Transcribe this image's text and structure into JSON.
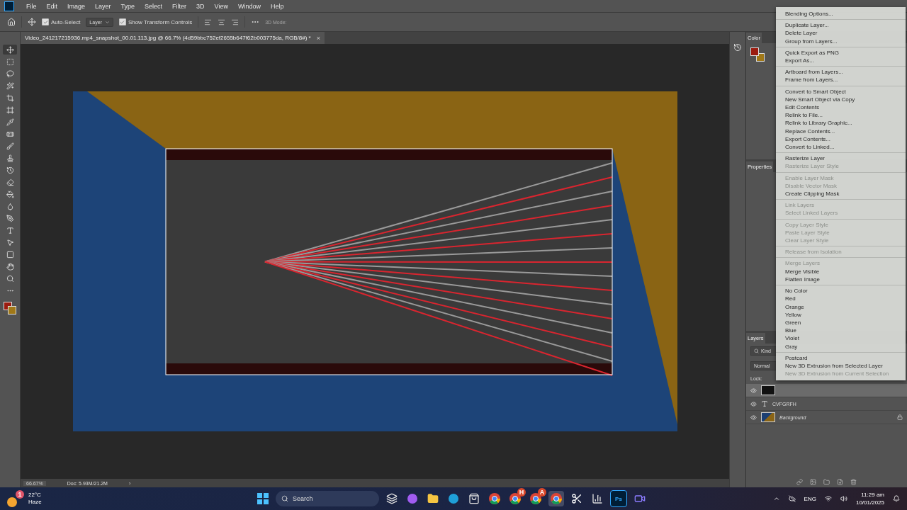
{
  "menubar": {
    "items": [
      "File",
      "Edit",
      "Image",
      "Layer",
      "Type",
      "Select",
      "Filter",
      "3D",
      "View",
      "Window",
      "Help"
    ]
  },
  "options_bar": {
    "auto_select": {
      "label": "Auto-Select",
      "checked": true
    },
    "target": {
      "value": "Layer"
    },
    "transform_controls": {
      "label": "Show Transform Controls",
      "checked": true
    },
    "mode_3d": {
      "label": "3D Mode:",
      "disabled": true
    }
  },
  "toolbar": {
    "tools": [
      {
        "selected": true
      },
      {
        "selected": false
      },
      {
        "selected": false
      },
      {
        "selected": false
      },
      {
        "selected": false
      },
      {
        "selected": false
      },
      {
        "selected": false
      },
      {
        "selected": false
      },
      {
        "selected": false
      },
      {
        "selected": false
      },
      {
        "selected": false
      },
      {
        "selected": false
      },
      {
        "selected": false
      },
      {
        "selected": false
      },
      {
        "selected": false
      },
      {
        "selected": false
      },
      {
        "selected": false
      },
      {
        "selected": false
      },
      {
        "selected": false
      },
      {
        "selected": false
      },
      {
        "selected": false
      }
    ]
  },
  "document_tab": {
    "title": "Video_241217215936.mp4_snapshot_00.01.113.jpg @ 66.7% (4d59bbc752ef2655b647f62b003775da, RGB/8#) *",
    "close": "×"
  },
  "status_bar": {
    "zoom": "66.67%",
    "doc": "Doc: 5.93M/21.2M",
    "arrow": "›"
  },
  "panels": {
    "color": {
      "title": "Color"
    },
    "properties": {
      "title": "Properties"
    },
    "layers": {
      "title": "Layers",
      "filter": "Kind",
      "blend_mode": "Normal",
      "lock": "Lock:",
      "layers": [
        {
          "kind": "smart",
          "visible": true,
          "selected": true,
          "locked": false
        },
        {
          "kind": "text",
          "name": "CVFGRFH",
          "visible": true,
          "selected": false,
          "locked": false
        },
        {
          "kind": "image",
          "name": "Background",
          "visible": true,
          "selected": false,
          "locked": true
        }
      ]
    }
  },
  "context_menu": {
    "groups": [
      [
        {
          "label": "Blending Options...",
          "disabled": false
        }
      ],
      [
        {
          "label": "Duplicate Layer...",
          "disabled": false
        },
        {
          "label": "Delete Layer",
          "disabled": false
        },
        {
          "label": "Group from Layers...",
          "disabled": false
        }
      ],
      [
        {
          "label": "Quick Export as PNG",
          "disabled": false
        },
        {
          "label": "Export As...",
          "disabled": false
        }
      ],
      [
        {
          "label": "Artboard from Layers...",
          "disabled": false
        },
        {
          "label": "Frame from Layers...",
          "disabled": false
        }
      ],
      [
        {
          "label": "Convert to Smart Object",
          "disabled": false
        },
        {
          "label": "New Smart Object via Copy",
          "disabled": false
        },
        {
          "label": "Edit Contents",
          "disabled": false
        },
        {
          "label": "Relink to File...",
          "disabled": false
        },
        {
          "label": "Relink to Library Graphic...",
          "disabled": false
        },
        {
          "label": "Replace Contents...",
          "disabled": false
        },
        {
          "label": "Export Contents...",
          "disabled": false
        },
        {
          "label": "Convert to Linked...",
          "disabled": false
        }
      ],
      [
        {
          "label": "Rasterize Layer",
          "disabled": false
        },
        {
          "label": "Rasterize Layer Style",
          "disabled": true
        }
      ],
      [
        {
          "label": "Enable Layer Mask",
          "disabled": true
        },
        {
          "label": "Disable Vector Mask",
          "disabled": true
        },
        {
          "label": "Create Clipping Mask",
          "disabled": false
        }
      ],
      [
        {
          "label": "Link Layers",
          "disabled": true
        },
        {
          "label": "Select Linked Layers",
          "disabled": true
        }
      ],
      [
        {
          "label": "Copy Layer Style",
          "disabled": true
        },
        {
          "label": "Paste Layer Style",
          "disabled": true
        },
        {
          "label": "Clear Layer Style",
          "disabled": true
        }
      ],
      [
        {
          "label": "Release from Isolation",
          "disabled": true
        }
      ],
      [
        {
          "label": "Merge Layers",
          "disabled": true
        },
        {
          "label": "Merge Visible",
          "disabled": false
        },
        {
          "label": "Flatten Image",
          "disabled": false
        }
      ],
      [
        {
          "label": "No Color",
          "disabled": false
        },
        {
          "label": "Red",
          "disabled": false
        },
        {
          "label": "Orange",
          "disabled": false
        },
        {
          "label": "Yellow",
          "disabled": false
        },
        {
          "label": "Green",
          "disabled": false
        },
        {
          "label": "Blue",
          "disabled": false
        },
        {
          "label": "Violet",
          "disabled": false
        },
        {
          "label": "Gray",
          "disabled": false
        }
      ],
      [
        {
          "label": "Postcard",
          "disabled": false
        },
        {
          "label": "New 3D Extrusion from Selected Layer",
          "disabled": false
        },
        {
          "label": "New 3D Extrusion from Current Selection",
          "disabled": true
        }
      ]
    ]
  },
  "taskbar": {
    "weather": {
      "temperature": "22°C",
      "condition": "Haze",
      "badge": "1"
    },
    "search": {
      "placeholder": "Search"
    },
    "apps": [
      {
        "kind": "windows"
      },
      {
        "kind": "taskview"
      },
      {
        "kind": "copilot"
      },
      {
        "kind": "folder"
      },
      {
        "kind": "edge"
      },
      {
        "kind": "store"
      },
      {
        "kind": "chrome",
        "selected": false
      },
      {
        "kind": "chrome",
        "badge": "H",
        "selected": false
      },
      {
        "kind": "chrome",
        "badge": "A",
        "selected": false
      },
      {
        "kind": "chrome",
        "selected": true
      },
      {
        "kind": "capcut"
      },
      {
        "kind": "chart"
      },
      {
        "kind": "photoshop",
        "label": "Ps"
      },
      {
        "kind": "video"
      }
    ],
    "language": "ENG",
    "time": "11:29 am",
    "date": "10/01/2025"
  }
}
